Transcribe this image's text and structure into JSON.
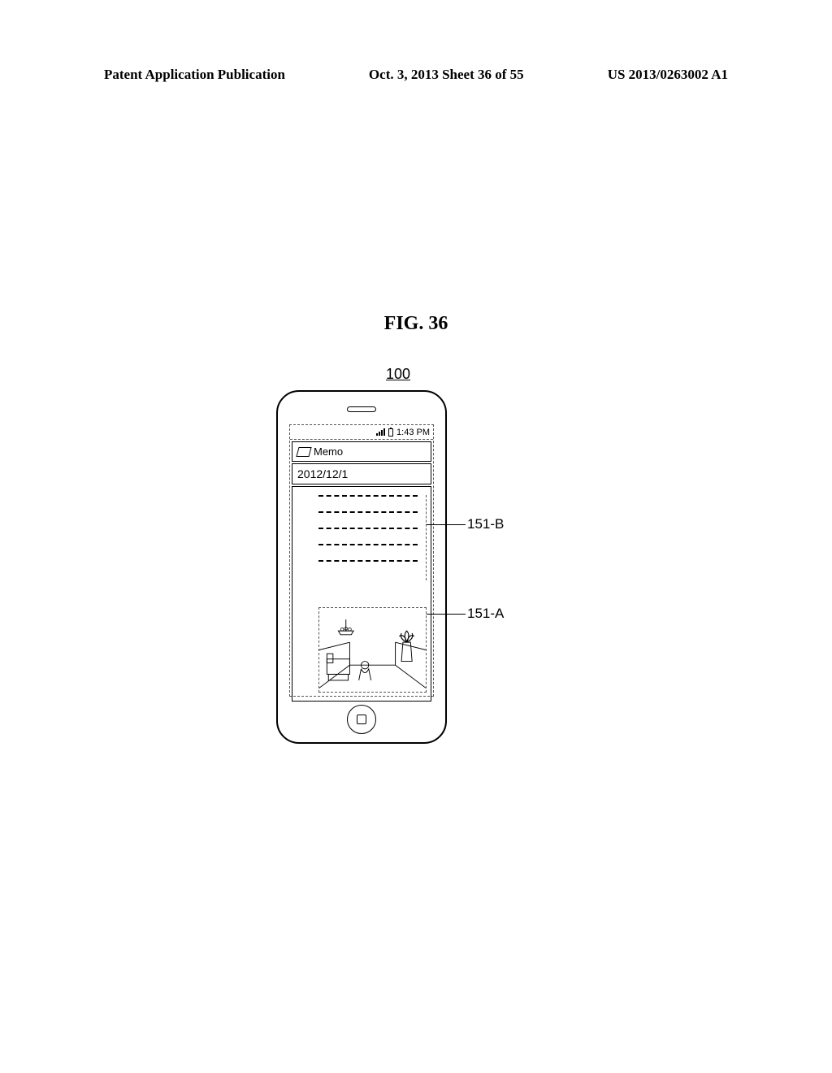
{
  "header": {
    "left": "Patent Application Publication",
    "center": "Oct. 3, 2013   Sheet 36 of 55",
    "right": "US 2013/0263002 A1"
  },
  "figure": {
    "title": "FIG. 36",
    "ref_device": "100",
    "ref_text_area": "151-B",
    "ref_image_area": "151-A"
  },
  "phone": {
    "status_time": "1:43  PM",
    "app_name": "Memo",
    "memo_date": "2012/12/1"
  }
}
